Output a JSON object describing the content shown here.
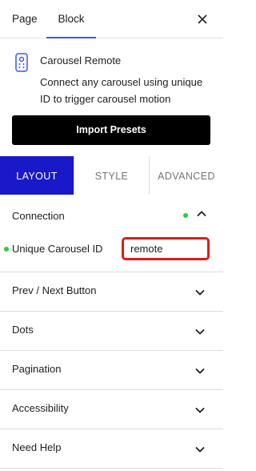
{
  "header": {
    "tabs": [
      "Page",
      "Block"
    ],
    "active_tab": "Block"
  },
  "block": {
    "name": "Carousel Remote",
    "description": "Connect any carousel using unique ID to trigger carousel motion",
    "import_button": "Import Presets",
    "icon": "remote-control-icon"
  },
  "tabs": [
    "LAYOUT",
    "STYLE",
    "ADVANCED"
  ],
  "active_tab": "LAYOUT",
  "connection": {
    "title": "Connection",
    "field_label": "Unique Carousel ID",
    "field_value": "remote"
  },
  "panels": [
    "Prev / Next Button",
    "Dots",
    "Pagination",
    "Accessibility",
    "Need Help"
  ],
  "colors": {
    "accent": "#3858e9",
    "active_tab": "#1919c9",
    "status_dot": "#2ecc40",
    "highlight": "#e01b1b"
  }
}
